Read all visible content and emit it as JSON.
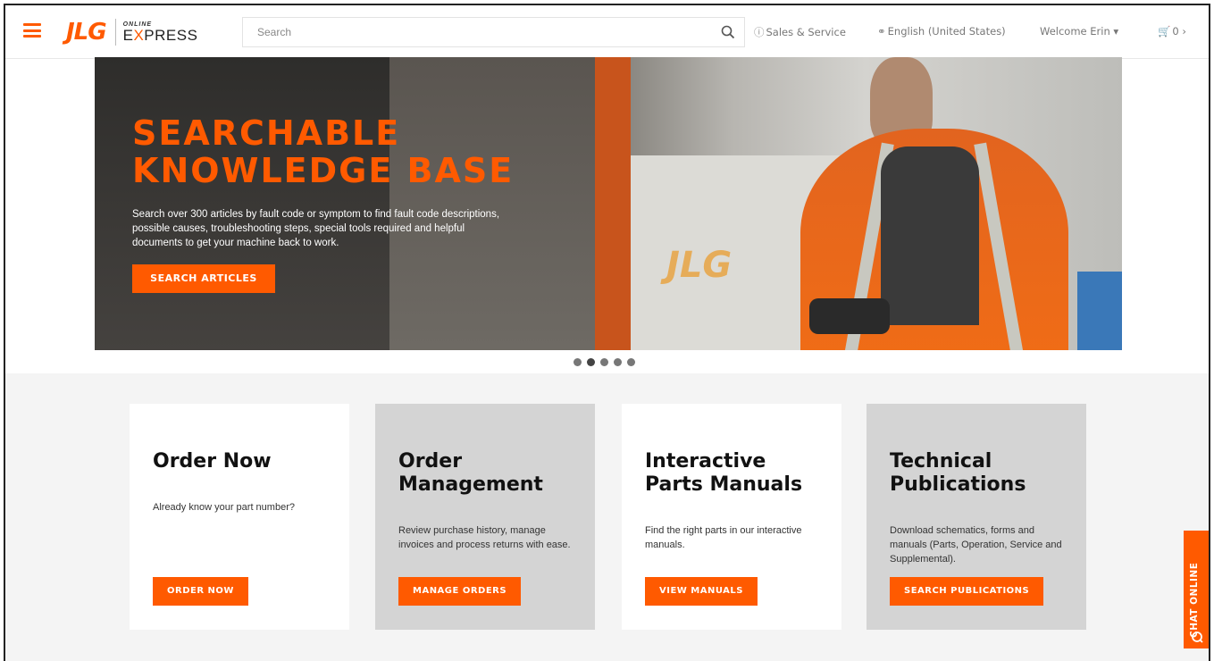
{
  "header": {
    "logo_brand": "JLG",
    "logo_online": "ONLINE",
    "logo_express_e": "E",
    "logo_express_x": "X",
    "logo_express_rest": "PRESS",
    "search_placeholder": "Search",
    "sales_service": "Sales & Service",
    "language": "English (United States)",
    "welcome": "Welcome Erin",
    "cart_count": "0"
  },
  "hero": {
    "title_line1": "SEARCHABLE",
    "title_line2": "KNOWLEDGE BASE",
    "description": "Search over 300 articles by fault code or symptom to find fault code descriptions, possible causes, troubleshooting steps, special tools required and helpful documents to get your machine back to work.",
    "button": "SEARCH ARTICLES",
    "watermark": "JLG",
    "slide_count": 5,
    "active_slide": 2
  },
  "cards": [
    {
      "title": "Order Now",
      "description": "Already know your part number?",
      "button": "ORDER NOW"
    },
    {
      "title": "Order Management",
      "description": "Review purchase history, manage invoices and process returns with ease.",
      "button": "MANAGE ORDERS"
    },
    {
      "title": "Interactive Parts Manuals",
      "description": "Find the right parts in our interactive manuals.",
      "button": "VIEW MANUALS"
    },
    {
      "title": "Technical Publications",
      "description": "Download schematics, forms and manuals (Parts, Operation, Service and Supplemental).",
      "button": "SEARCH PUBLICATIONS"
    }
  ],
  "chat": {
    "label": "CHAT ONLINE"
  },
  "colors": {
    "accent": "#ff5a00",
    "grey_card": "#d4d4d4",
    "page_bg": "#f4f4f4"
  }
}
